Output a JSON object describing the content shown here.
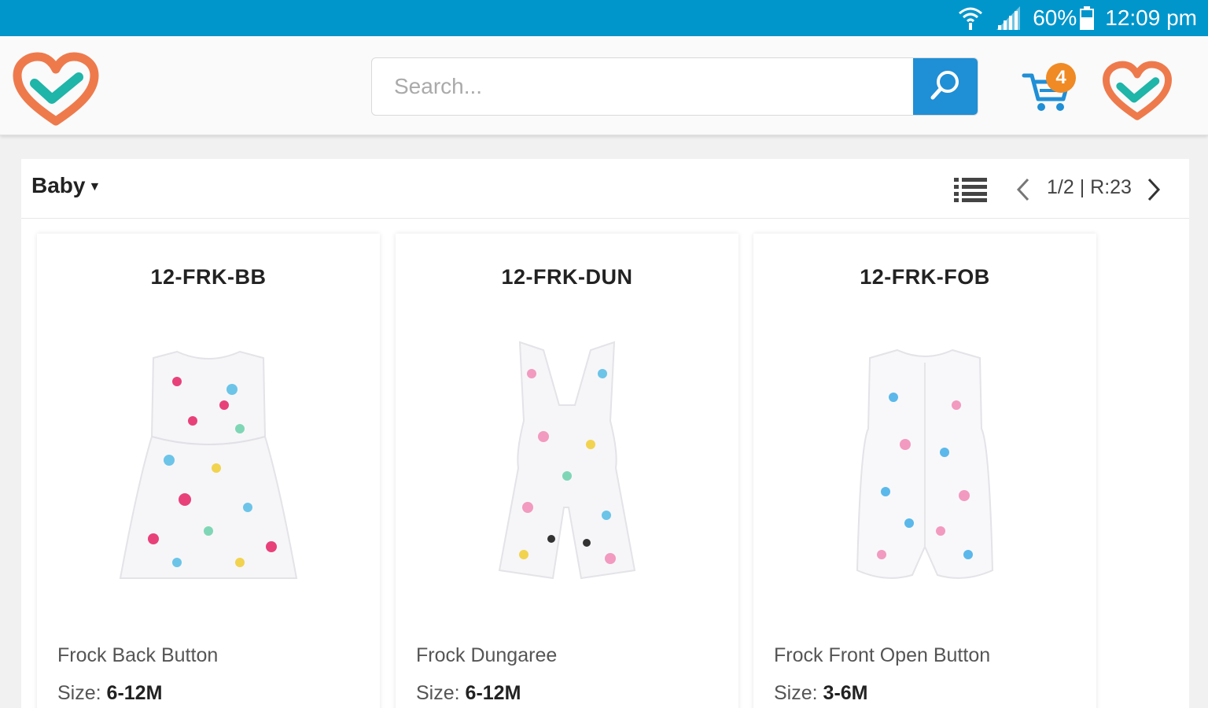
{
  "status_bar": {
    "battery_percent": "60%",
    "time": "12:09 pm",
    "icons": [
      "wifi-icon",
      "signal-icon",
      "battery-icon"
    ]
  },
  "header": {
    "logo_icon": "heart-check-logo",
    "search": {
      "placeholder": "Search...",
      "value": ""
    },
    "search_icon": "search-icon",
    "cart": {
      "icon": "cart-icon",
      "count": "4"
    },
    "profile_icon": "heart-check-logo",
    "colors": {
      "status_bar": "#0096cc",
      "search_button": "#1f8fd6",
      "badge": "#f08a24"
    }
  },
  "filter_bar": {
    "category": "Baby",
    "list_view_icon": "list-view-icon",
    "pagination": "1/2 | R:23"
  },
  "products": [
    {
      "code": "12-FRK-BB",
      "name": "Frock Back Button",
      "size_label": "Size:",
      "size": "6-12M"
    },
    {
      "code": "12-FRK-DUN",
      "name": "Frock Dungaree",
      "size_label": "Size:",
      "size": "6-12M"
    },
    {
      "code": "12-FRK-FOB",
      "name": "Frock Front Open Button",
      "size_label": "Size:",
      "size": "3-6M"
    }
  ]
}
